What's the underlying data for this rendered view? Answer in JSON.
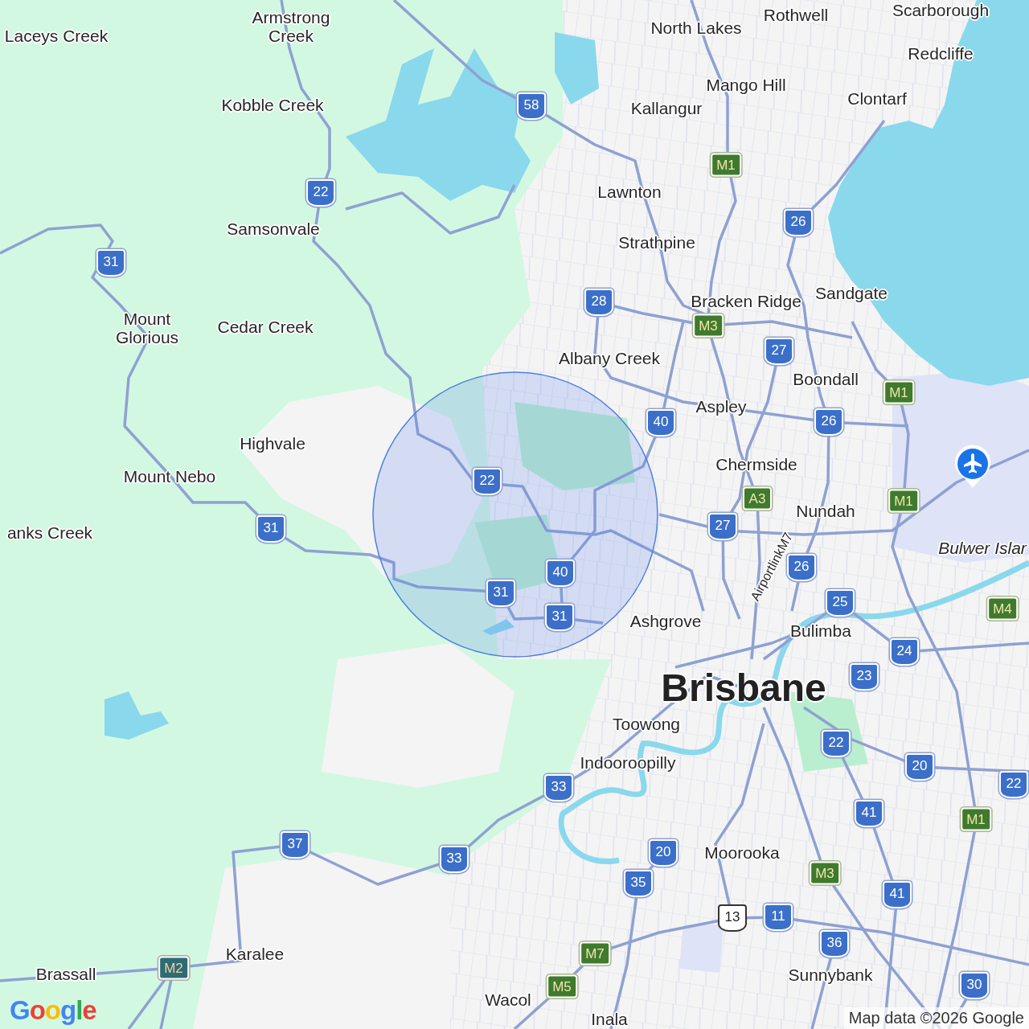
{
  "places": [
    {
      "name": "Laceys Creek",
      "kind": "suburb"
    },
    {
      "name": "Armstrong Creek",
      "kind": "suburb"
    },
    {
      "name": "Kobble Creek",
      "kind": "suburb"
    },
    {
      "name": "Samsonvale",
      "kind": "suburb"
    },
    {
      "name": "Mount Glorious",
      "kind": "suburb"
    },
    {
      "name": "Cedar Creek",
      "kind": "suburb"
    },
    {
      "name": "Highvale",
      "kind": "suburb"
    },
    {
      "name": "Mount Nebo",
      "kind": "suburb"
    },
    {
      "name": "anks Creek",
      "kind": "suburb"
    },
    {
      "name": "Rothwell",
      "kind": "suburb"
    },
    {
      "name": "Scarborough",
      "kind": "suburb"
    },
    {
      "name": "North Lakes",
      "kind": "suburb"
    },
    {
      "name": "Redcliffe",
      "kind": "suburb"
    },
    {
      "name": "Mango Hill",
      "kind": "suburb"
    },
    {
      "name": "Kallangur",
      "kind": "suburb"
    },
    {
      "name": "Clontarf",
      "kind": "suburb"
    },
    {
      "name": "Lawnton",
      "kind": "suburb"
    },
    {
      "name": "Strathpine",
      "kind": "suburb"
    },
    {
      "name": "Bracken Ridge",
      "kind": "suburb"
    },
    {
      "name": "Sandgate",
      "kind": "suburb"
    },
    {
      "name": "Albany Creek",
      "kind": "suburb"
    },
    {
      "name": "Boondall",
      "kind": "suburb"
    },
    {
      "name": "Aspley",
      "kind": "suburb"
    },
    {
      "name": "Chermside",
      "kind": "suburb"
    },
    {
      "name": "Nundah",
      "kind": "suburb"
    },
    {
      "name": "Bulwer Islar",
      "kind": "locality"
    },
    {
      "name": "AirportlinkM7",
      "kind": "road"
    },
    {
      "name": "Ashgrove",
      "kind": "suburb"
    },
    {
      "name": "Bulimba",
      "kind": "suburb"
    },
    {
      "name": "Brisbane",
      "kind": "city"
    },
    {
      "name": "Toowong",
      "kind": "suburb"
    },
    {
      "name": "Indooroopilly",
      "kind": "suburb"
    },
    {
      "name": "Moorooka",
      "kind": "suburb"
    },
    {
      "name": "Sunnybank",
      "kind": "suburb"
    },
    {
      "name": "Karalee",
      "kind": "suburb"
    },
    {
      "name": "Brassall",
      "kind": "suburb"
    },
    {
      "name": "Wacol",
      "kind": "suburb"
    },
    {
      "name": "Inala",
      "kind": "suburb"
    }
  ],
  "shields": [
    {
      "number": "22",
      "kind": "state"
    },
    {
      "number": "31",
      "kind": "state"
    },
    {
      "number": "58",
      "kind": "state"
    },
    {
      "number": "M1",
      "kind": "motorway"
    },
    {
      "number": "26",
      "kind": "state"
    },
    {
      "number": "28",
      "kind": "state"
    },
    {
      "number": "M3",
      "kind": "motorway"
    },
    {
      "number": "27",
      "kind": "state"
    },
    {
      "number": "M1",
      "kind": "motorway"
    },
    {
      "number": "40",
      "kind": "state"
    },
    {
      "number": "26",
      "kind": "state"
    },
    {
      "number": "22",
      "kind": "state"
    },
    {
      "number": "A3",
      "kind": "motorway"
    },
    {
      "number": "M1",
      "kind": "motorway"
    },
    {
      "number": "27",
      "kind": "state"
    },
    {
      "number": "31",
      "kind": "state"
    },
    {
      "number": "26",
      "kind": "state"
    },
    {
      "number": "40",
      "kind": "state"
    },
    {
      "number": "31",
      "kind": "state"
    },
    {
      "number": "25",
      "kind": "state"
    },
    {
      "number": "M4",
      "kind": "motorway"
    },
    {
      "number": "31",
      "kind": "state"
    },
    {
      "number": "24",
      "kind": "state"
    },
    {
      "number": "23",
      "kind": "state"
    },
    {
      "number": "22",
      "kind": "state"
    },
    {
      "number": "20",
      "kind": "state"
    },
    {
      "number": "22",
      "kind": "state"
    },
    {
      "number": "33",
      "kind": "state"
    },
    {
      "number": "41",
      "kind": "state"
    },
    {
      "number": "M1",
      "kind": "motorway"
    },
    {
      "number": "20",
      "kind": "state"
    },
    {
      "number": "33",
      "kind": "state"
    },
    {
      "number": "37",
      "kind": "state"
    },
    {
      "number": "M3",
      "kind": "motorway"
    },
    {
      "number": "35",
      "kind": "state"
    },
    {
      "number": "41",
      "kind": "state"
    },
    {
      "number": "13",
      "kind": "national"
    },
    {
      "number": "11",
      "kind": "state"
    },
    {
      "number": "36",
      "kind": "state"
    },
    {
      "number": "M7",
      "kind": "motorway"
    },
    {
      "number": "M2",
      "kind": "metro"
    },
    {
      "number": "M5",
      "kind": "motorway"
    },
    {
      "number": "30",
      "kind": "state"
    }
  ],
  "logo": "Google",
  "attribution": "Map data ©2026 Google"
}
